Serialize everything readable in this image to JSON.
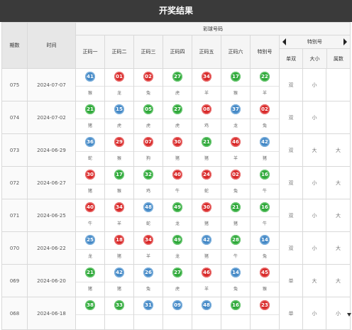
{
  "header": {
    "title": "开奖结果"
  },
  "table": {
    "col_period": "期数",
    "col_date": "时间",
    "group_label": "彩球号码",
    "ball_headers": [
      "正码一",
      "正码二",
      "正码三",
      "正码四",
      "正码五",
      "正码六",
      "特别号"
    ],
    "special_label": "特别号",
    "special_sub": [
      "单双",
      "大小",
      "属数"
    ],
    "rows": [
      {
        "period": "075",
        "date": "2024-07-07",
        "balls": [
          {
            "n": "41",
            "c": "blue",
            "z": "猴"
          },
          {
            "n": "01",
            "c": "red",
            "z": "龙"
          },
          {
            "n": "02",
            "c": "red",
            "z": "兔"
          },
          {
            "n": "27",
            "c": "green",
            "z": "虎"
          },
          {
            "n": "34",
            "c": "red",
            "z": "羊"
          },
          {
            "n": "17",
            "c": "green",
            "z": "猴"
          },
          {
            "n": "22",
            "c": "green",
            "z": "羊"
          }
        ],
        "attrs": [
          "双",
          "小",
          ""
        ]
      },
      {
        "period": "074",
        "date": "2024-07-02",
        "balls": [
          {
            "n": "21",
            "c": "green",
            "z": "猪"
          },
          {
            "n": "15",
            "c": "blue",
            "z": "虎"
          },
          {
            "n": "05",
            "c": "green",
            "z": "虎"
          },
          {
            "n": "27",
            "c": "green",
            "z": "虎"
          },
          {
            "n": "08",
            "c": "red",
            "z": "鸡"
          },
          {
            "n": "37",
            "c": "blue",
            "z": "龙"
          },
          {
            "n": "02",
            "c": "red",
            "z": "兔"
          }
        ],
        "attrs": [
          "双",
          "小",
          ""
        ]
      },
      {
        "period": "073",
        "date": "2024-06-29",
        "balls": [
          {
            "n": "36",
            "c": "blue",
            "z": "蛇"
          },
          {
            "n": "29",
            "c": "red",
            "z": "猴"
          },
          {
            "n": "07",
            "c": "red",
            "z": "狗"
          },
          {
            "n": "30",
            "c": "red",
            "z": "猪"
          },
          {
            "n": "21",
            "c": "green",
            "z": "猪"
          },
          {
            "n": "46",
            "c": "red",
            "z": "羊"
          },
          {
            "n": "42",
            "c": "blue",
            "z": "猪"
          }
        ],
        "attrs": [
          "双",
          "大",
          "大"
        ]
      },
      {
        "period": "072",
        "date": "2024-06-27",
        "balls": [
          {
            "n": "30",
            "c": "red",
            "z": "猪"
          },
          {
            "n": "17",
            "c": "green",
            "z": "猴"
          },
          {
            "n": "32",
            "c": "green",
            "z": "鸡"
          },
          {
            "n": "40",
            "c": "red",
            "z": "牛"
          },
          {
            "n": "24",
            "c": "red",
            "z": "蛇"
          },
          {
            "n": "02",
            "c": "red",
            "z": "兔"
          },
          {
            "n": "16",
            "c": "green",
            "z": "牛"
          }
        ],
        "attrs": [
          "双",
          "小",
          "大"
        ]
      },
      {
        "period": "071",
        "date": "2024-06-25",
        "balls": [
          {
            "n": "40",
            "c": "red",
            "z": "牛"
          },
          {
            "n": "34",
            "c": "red",
            "z": "羊"
          },
          {
            "n": "48",
            "c": "blue",
            "z": "蛇"
          },
          {
            "n": "49",
            "c": "green",
            "z": "龙"
          },
          {
            "n": "30",
            "c": "red",
            "z": "猪"
          },
          {
            "n": "21",
            "c": "green",
            "z": "猪"
          },
          {
            "n": "16",
            "c": "green",
            "z": "牛"
          }
        ],
        "attrs": [
          "双",
          "小",
          "大"
        ]
      },
      {
        "period": "070",
        "date": "2024-06-22",
        "balls": [
          {
            "n": "25",
            "c": "blue",
            "z": "龙"
          },
          {
            "n": "18",
            "c": "red",
            "z": "猪"
          },
          {
            "n": "34",
            "c": "red",
            "z": "羊"
          },
          {
            "n": "49",
            "c": "green",
            "z": "龙"
          },
          {
            "n": "42",
            "c": "blue",
            "z": "猪"
          },
          {
            "n": "28",
            "c": "green",
            "z": "牛"
          },
          {
            "n": "14",
            "c": "blue",
            "z": "兔"
          }
        ],
        "attrs": [
          "双",
          "小",
          "大"
        ]
      },
      {
        "period": "069",
        "date": "2024-06-20",
        "balls": [
          {
            "n": "21",
            "c": "green",
            "z": "猪"
          },
          {
            "n": "42",
            "c": "blue",
            "z": "猪"
          },
          {
            "n": "26",
            "c": "blue",
            "z": "兔"
          },
          {
            "n": "27",
            "c": "green",
            "z": "虎"
          },
          {
            "n": "46",
            "c": "red",
            "z": "羊"
          },
          {
            "n": "14",
            "c": "blue",
            "z": "兔"
          },
          {
            "n": "45",
            "c": "red",
            "z": "猴"
          }
        ],
        "attrs": [
          "单",
          "大",
          "大"
        ]
      },
      {
        "period": "068",
        "date": "2024-06-18",
        "balls": [
          {
            "n": "38",
            "c": "green",
            "z": ""
          },
          {
            "n": "33",
            "c": "green",
            "z": ""
          },
          {
            "n": "31",
            "c": "blue",
            "z": ""
          },
          {
            "n": "09",
            "c": "blue",
            "z": ""
          },
          {
            "n": "48",
            "c": "blue",
            "z": ""
          },
          {
            "n": "16",
            "c": "green",
            "z": ""
          },
          {
            "n": "23",
            "c": "red",
            "z": ""
          }
        ],
        "attrs": [
          "单",
          "小",
          "小"
        ]
      }
    ]
  }
}
